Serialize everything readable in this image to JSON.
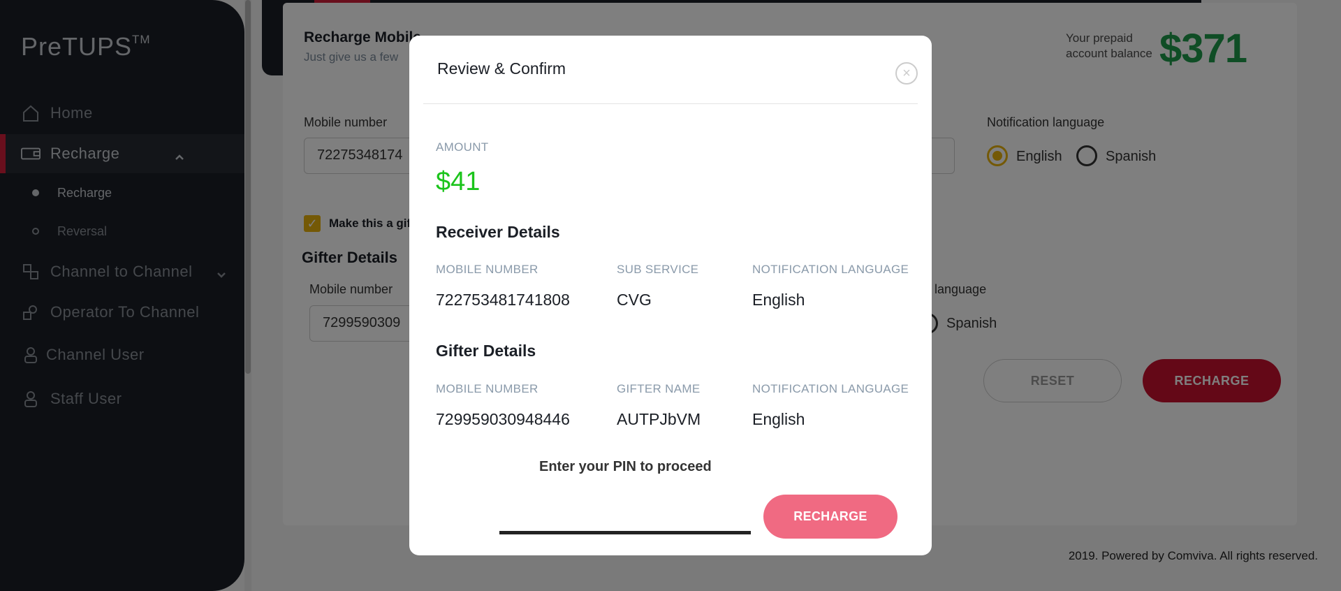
{
  "sidebar": {
    "logo": "PreTUPS",
    "logo_tm": "TM",
    "items": [
      {
        "label": "Home",
        "icon": "home-icon"
      },
      {
        "label": "Recharge",
        "icon": "recharge-icon"
      },
      {
        "label": "Channel to Channel",
        "icon": "channel-icon"
      },
      {
        "label": "Operator To Channel",
        "icon": "operator-icon"
      },
      {
        "label": "Channel User",
        "icon": "user-icon"
      },
      {
        "label": "Staff User",
        "icon": "user-icon"
      }
    ],
    "subitems": [
      {
        "label": "Recharge"
      },
      {
        "label": "Reversal"
      }
    ]
  },
  "page": {
    "title": "Recharge Mobile",
    "subtitle": "Just give us a few",
    "balance_label_1": "Your prepaid",
    "balance_label_2": "account balance",
    "balance_value": "$371",
    "mobile_label": "Mobile number",
    "mobile_value": "72275348174",
    "notif_label": "Notification language",
    "lang_english": "English",
    "lang_spanish": "Spanish",
    "gift_checkbox_label": "Make this a gif",
    "gifter_section": "Gifter Details",
    "gifter_mobile_label": "Mobile number",
    "gifter_mobile_value": "7299590309",
    "gifter_lang_label": "language",
    "gifter_lang_spanish": "Spanish",
    "reset_label": "RESET",
    "recharge_label": "RECHARGE",
    "footer": "2019. Powered by Comviva. All rights reserved."
  },
  "modal": {
    "title": "Review & Confirm",
    "close_icon": "close-icon",
    "amount_label": "AMOUNT",
    "amount": "$41",
    "receiver_heading": "Receiver Details",
    "receiver": {
      "mobile_label": "MOBILE NUMBER",
      "mobile": "722753481741808",
      "sub_service_label": "SUB SERVICE",
      "sub_service": "CVG",
      "notif_label": "NOTIFICATION LANGUAGE",
      "notif": "English"
    },
    "gifter_heading": "Gifter Details",
    "gifter": {
      "mobile_label": "MOBILE NUMBER",
      "mobile": "729959030948446",
      "name_label": "GIFTER NAME",
      "name": "AUTPJbVM",
      "notif_label": "NOTIFICATION LANGUAGE",
      "notif": "English"
    },
    "pin_label": "Enter your PIN to proceed",
    "recharge_button": "RECHARGE"
  },
  "colors": {
    "accent_red": "#c8102e",
    "amount_green": "#1bc41b",
    "balance_green": "#1f9b4a",
    "radio_yellow": "#e8b20c"
  }
}
